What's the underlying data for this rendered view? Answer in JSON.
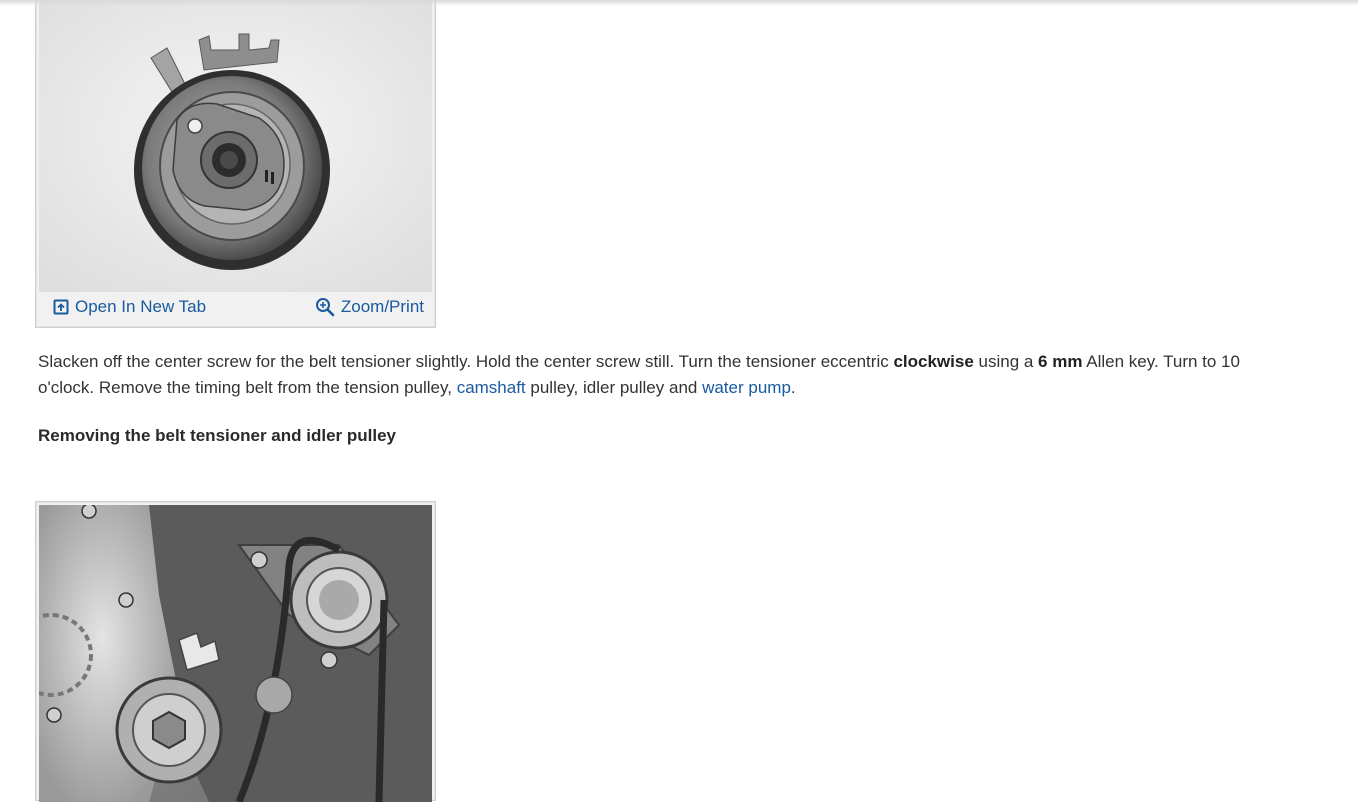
{
  "figure1": {
    "open_new_tab_label": "Open In New Tab",
    "zoom_print_label": "Zoom/Print",
    "open_icon": "open-in-new-tab-icon",
    "zoom_icon": "zoom-icon"
  },
  "instruction": {
    "part1": "Slacken off the center screw for the belt tensioner slightly. Hold the center screw still. Turn the tensioner eccentric ",
    "bold1": "clockwise",
    "part2": " using a ",
    "bold2": "6 mm",
    "part3": " Allen key. Turn to 10 o'clock. Remove the timing belt from the tension pulley, ",
    "link_camshaft": "camshaft",
    "part4": " pulley, idler pulley and ",
    "link_water_pump": "water pump",
    "part5": "."
  },
  "section": {
    "heading": "Removing the belt tensioner and idler pulley"
  },
  "colors": {
    "link": "#1a5aa0",
    "text": "#333333"
  }
}
